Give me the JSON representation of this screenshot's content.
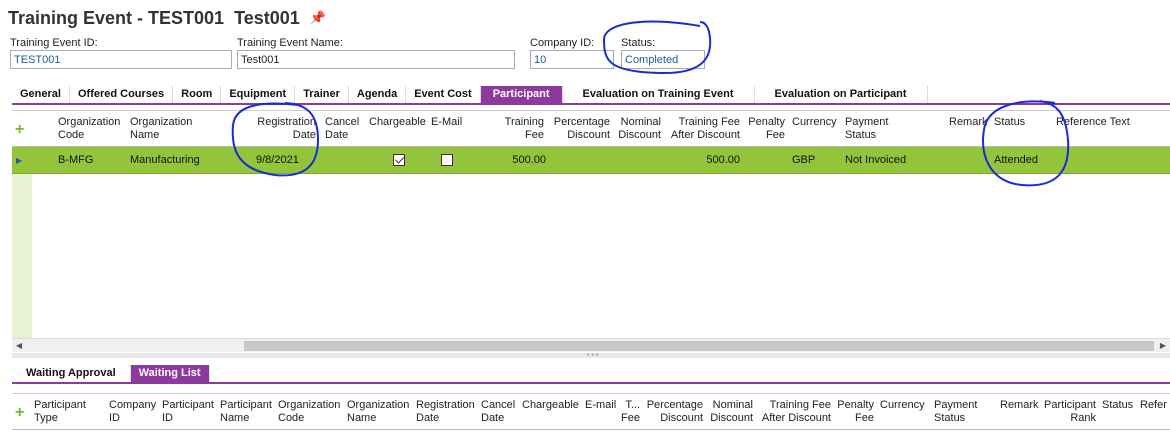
{
  "header": {
    "title_prefix": "Training Event - TEST001",
    "title_suffix": "Test001"
  },
  "fields": {
    "event_id_label": "Training Event ID:",
    "event_id_value": "TEST001",
    "event_name_label": "Training Event Name:",
    "event_name_value": "Test001",
    "company_label": "Company ID:",
    "company_value": "10",
    "status_label": "Status:",
    "status_value": "Completed"
  },
  "tabs": [
    "General",
    "Offered Courses",
    "Room",
    "Equipment",
    "Trainer",
    "Agenda",
    "Event Cost",
    "Participant",
    "Evaluation on Training Event",
    "Evaluation on Participant"
  ],
  "active_tab": "Participant",
  "participants": {
    "columns": {
      "org_code": [
        "Organization",
        "Code"
      ],
      "org_name": [
        "Organization",
        "Name"
      ],
      "reg_date": [
        "Registration",
        "Date"
      ],
      "cancel_date": [
        "Cancel",
        "Date"
      ],
      "chargeable": "Chargeable",
      "email": "E-Mail",
      "training_fee": [
        "Training",
        "Fee"
      ],
      "pct_discount": [
        "Percentage",
        "Discount"
      ],
      "nominal_discount": [
        "Nominal",
        "Discount"
      ],
      "fee_after": [
        "Training Fee",
        "After Discount"
      ],
      "penalty": [
        "Penalty",
        "Fee"
      ],
      "currency": "Currency",
      "payment_status": [
        "Payment",
        "Status"
      ],
      "remark": "Remark",
      "status": "Status",
      "reference": "Reference Text"
    },
    "rows": [
      {
        "org_code": "B-MFG",
        "org_name": "Manufacturing",
        "reg_date": "9/8/2021",
        "chargeable": true,
        "email": false,
        "training_fee": "500.00",
        "fee_after": "500.00",
        "currency": "GBP",
        "payment_status": "Not Invoiced",
        "status": "Attended"
      }
    ]
  },
  "sub_tabs": [
    "Waiting Approval",
    "Waiting List"
  ],
  "active_sub_tab": "Waiting List",
  "waiting": {
    "columns": {
      "p_type": [
        "Participant",
        "Type"
      ],
      "company": [
        "Company",
        "ID"
      ],
      "p_id": [
        "Participant",
        "ID"
      ],
      "p_name": [
        "Participant",
        "Name"
      ],
      "org_code": [
        "Organization",
        "Code"
      ],
      "org_name": [
        "Organization",
        "Name"
      ],
      "reg_date": [
        "Registration",
        "Date"
      ],
      "cancel_date": [
        "Cancel",
        "Date"
      ],
      "chargeable": "Chargeable",
      "email": "E-mail",
      "t_fee": [
        "T...",
        "Fee"
      ],
      "pct_discount": [
        "Percentage",
        "Discount"
      ],
      "nominal": [
        "Nominal",
        "Discount"
      ],
      "fee_after": [
        "Training Fee",
        "After Discount"
      ],
      "penalty": [
        "Penalty",
        "Fee"
      ],
      "currency": "Currency",
      "payment": [
        "Payment",
        "Status"
      ],
      "remark": "Remark",
      "rank": [
        "Participant",
        "Rank"
      ],
      "status": "Status",
      "refer": "Refer"
    }
  },
  "colors": {
    "accent": "#8d3a9e",
    "row_selected": "#94c43a",
    "annotation": "#1a2bd6"
  }
}
